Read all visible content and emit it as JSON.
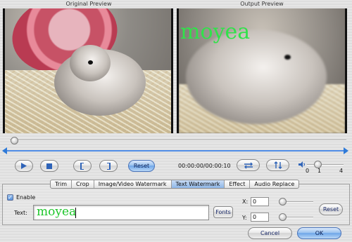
{
  "previews": {
    "original_title": "Original Preview",
    "output_title": "Output Preview",
    "watermark_overlay": "moyea"
  },
  "playback": {
    "reset_label": "Reset",
    "time": "00:00:00/00:00:10",
    "volume_ticks": [
      "0",
      "1",
      "4"
    ],
    "volume_level": 1
  },
  "tabs": [
    {
      "label": "Trim",
      "active": false
    },
    {
      "label": "Crop",
      "active": false
    },
    {
      "label": "Image/Video Watermark",
      "active": false
    },
    {
      "label": "Text Watermark",
      "active": true
    },
    {
      "label": "Effect",
      "active": false
    },
    {
      "label": "Audio Replace",
      "active": false
    }
  ],
  "watermark": {
    "enable_label": "Enable",
    "enabled": true,
    "text_label": "Text:",
    "text_value": "moyea",
    "fonts_label": "Fonts",
    "x_label": "X:",
    "x_value": "0",
    "y_label": "Y:",
    "y_value": "0",
    "reset_label": "Reset"
  },
  "dialog": {
    "cancel_label": "Cancel",
    "ok_label": "OK"
  },
  "colors": {
    "watermark_text": "#30e24a",
    "accent_blue": "#2e7ad8"
  }
}
